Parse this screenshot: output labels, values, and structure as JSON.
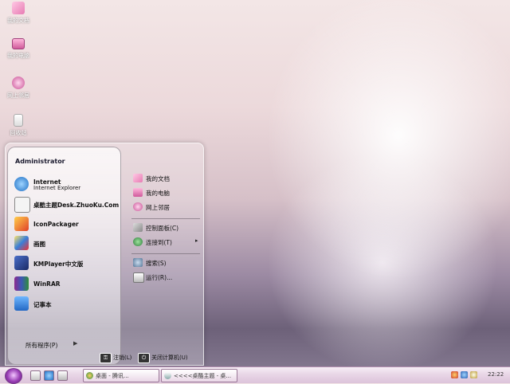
{
  "desktop": {
    "icons": [
      {
        "label": "我的文档",
        "icon": "folder-icon"
      },
      {
        "label": "我的电脑",
        "icon": "computer-icon"
      },
      {
        "label": "网上邻居",
        "icon": "network-icon"
      },
      {
        "label": "回收站",
        "icon": "recycle-bin-icon"
      }
    ]
  },
  "start_menu": {
    "user": "Administrator",
    "programs": [
      {
        "title": "Internet",
        "subtitle": "Internet Explorer",
        "icon": "ie-icon"
      },
      {
        "title": "桌酷主题Desk.ZhuoKu.Com",
        "subtitle": "",
        "icon": "zhuoku-icon"
      },
      {
        "title": "IconPackager",
        "subtitle": "",
        "icon": "iconpackager-icon"
      },
      {
        "title": "画图",
        "subtitle": "",
        "icon": "paint-icon"
      },
      {
        "title": "KMPlayer中文版",
        "subtitle": "",
        "icon": "kmplayer-icon"
      },
      {
        "title": "WinRAR",
        "subtitle": "",
        "icon": "winrar-icon"
      },
      {
        "title": "记事本",
        "subtitle": "",
        "icon": "notepad-icon"
      }
    ],
    "all_programs": "所有程序(P)",
    "right": [
      {
        "label": "我的文档",
        "icon": "folder-icon"
      },
      {
        "label": "我的电脑",
        "icon": "computer-icon"
      },
      {
        "label": "网上邻居",
        "icon": "network-icon"
      },
      {
        "label": "控制面板(C)",
        "icon": "control-panel-icon"
      },
      {
        "label": "连接到(T)",
        "icon": "connect-icon",
        "arrow": "▸"
      },
      {
        "label": "搜索(S)",
        "icon": "search-icon"
      },
      {
        "label": "运行(R)...",
        "icon": "run-icon"
      }
    ],
    "logoff": "注销(L)",
    "shutdown": "关闭计算机(U)"
  },
  "taskbar": {
    "tasks": [
      {
        "label": "桌面 - 腾讯...",
        "icon": "browser-icon"
      },
      {
        "label": "<<<<桌酷主题 - 桌...",
        "icon": "window-icon"
      }
    ],
    "clock": "22:22"
  },
  "colors": {
    "accent": "#c84f94",
    "start_orb": "#9a3fb6"
  }
}
